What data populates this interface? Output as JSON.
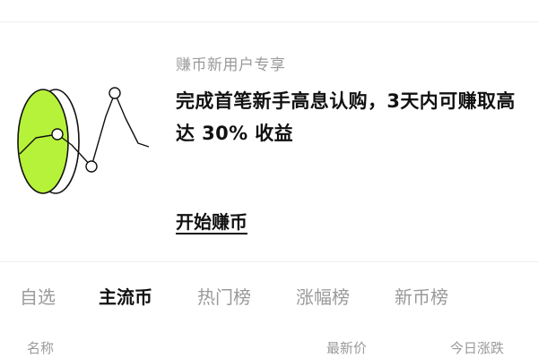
{
  "promo": {
    "subtitle": "赚币新用户专享",
    "headline": "完成首笔新手高息认购，3天内可赚取高达 30% 收益",
    "cta_label": "开始赚币",
    "graphic_icon": "coin-chart-illustration",
    "accent_color": "#b6f23a"
  },
  "tabs": [
    {
      "label": "自选",
      "active": false
    },
    {
      "label": "主流币",
      "active": true
    },
    {
      "label": "热门榜",
      "active": false
    },
    {
      "label": "涨幅榜",
      "active": false
    },
    {
      "label": "新币榜",
      "active": false
    }
  ],
  "list_header": {
    "name": "名称",
    "last_price": "最新价",
    "change_today": "今日涨跌"
  }
}
